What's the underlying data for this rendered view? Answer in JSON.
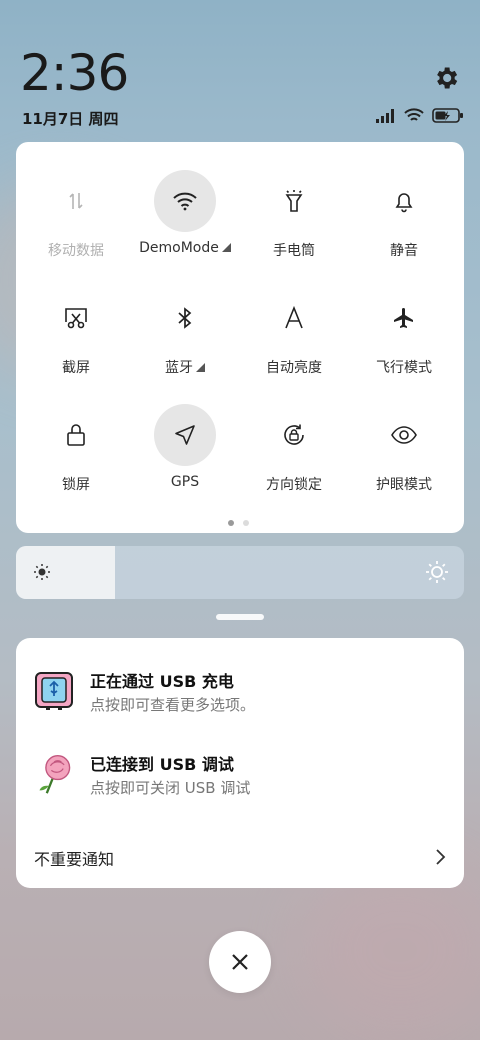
{
  "status": {
    "time": "2:36",
    "date": "11月7日 周四",
    "icons": [
      "signal-icon",
      "wifi-icon",
      "battery-charging-icon"
    ]
  },
  "quick_settings": {
    "tiles": [
      {
        "label": "移动数据",
        "icon": "mobile-data-icon",
        "active": false,
        "disabled": true
      },
      {
        "label": "DemoMode",
        "icon": "wifi-icon",
        "active": true,
        "expandable": true
      },
      {
        "label": "手电筒",
        "icon": "flashlight-icon",
        "active": false
      },
      {
        "label": "静音",
        "icon": "bell-icon",
        "active": false
      },
      {
        "label": "截屏",
        "icon": "screenshot-icon",
        "active": false
      },
      {
        "label": "蓝牙",
        "icon": "bluetooth-icon",
        "active": false,
        "expandable": true
      },
      {
        "label": "自动亮度",
        "icon": "auto-brightness-icon",
        "active": false
      },
      {
        "label": "飞行模式",
        "icon": "airplane-icon",
        "active": false
      },
      {
        "label": "锁屏",
        "icon": "lock-icon",
        "active": false
      },
      {
        "label": "GPS",
        "icon": "location-arrow-icon",
        "active": true
      },
      {
        "label": "方向锁定",
        "icon": "rotation-lock-icon",
        "active": false
      },
      {
        "label": "护眼模式",
        "icon": "eye-icon",
        "active": false
      }
    ],
    "page_index": 1,
    "page_count": 2
  },
  "brightness": {
    "level": 0.22
  },
  "notifications": [
    {
      "title": "正在通过 USB 充电",
      "subtitle": "点按即可查看更多选项。",
      "icon": "usb-charging-icon"
    },
    {
      "title": "已连接到 USB 调试",
      "subtitle": "点按即可关闭 USB 调试",
      "icon": "rose-icon"
    }
  ],
  "unimportant_label": "不重要通知",
  "colors": {
    "panel": "#ffffff",
    "active_tile": "#e6e6e6"
  }
}
